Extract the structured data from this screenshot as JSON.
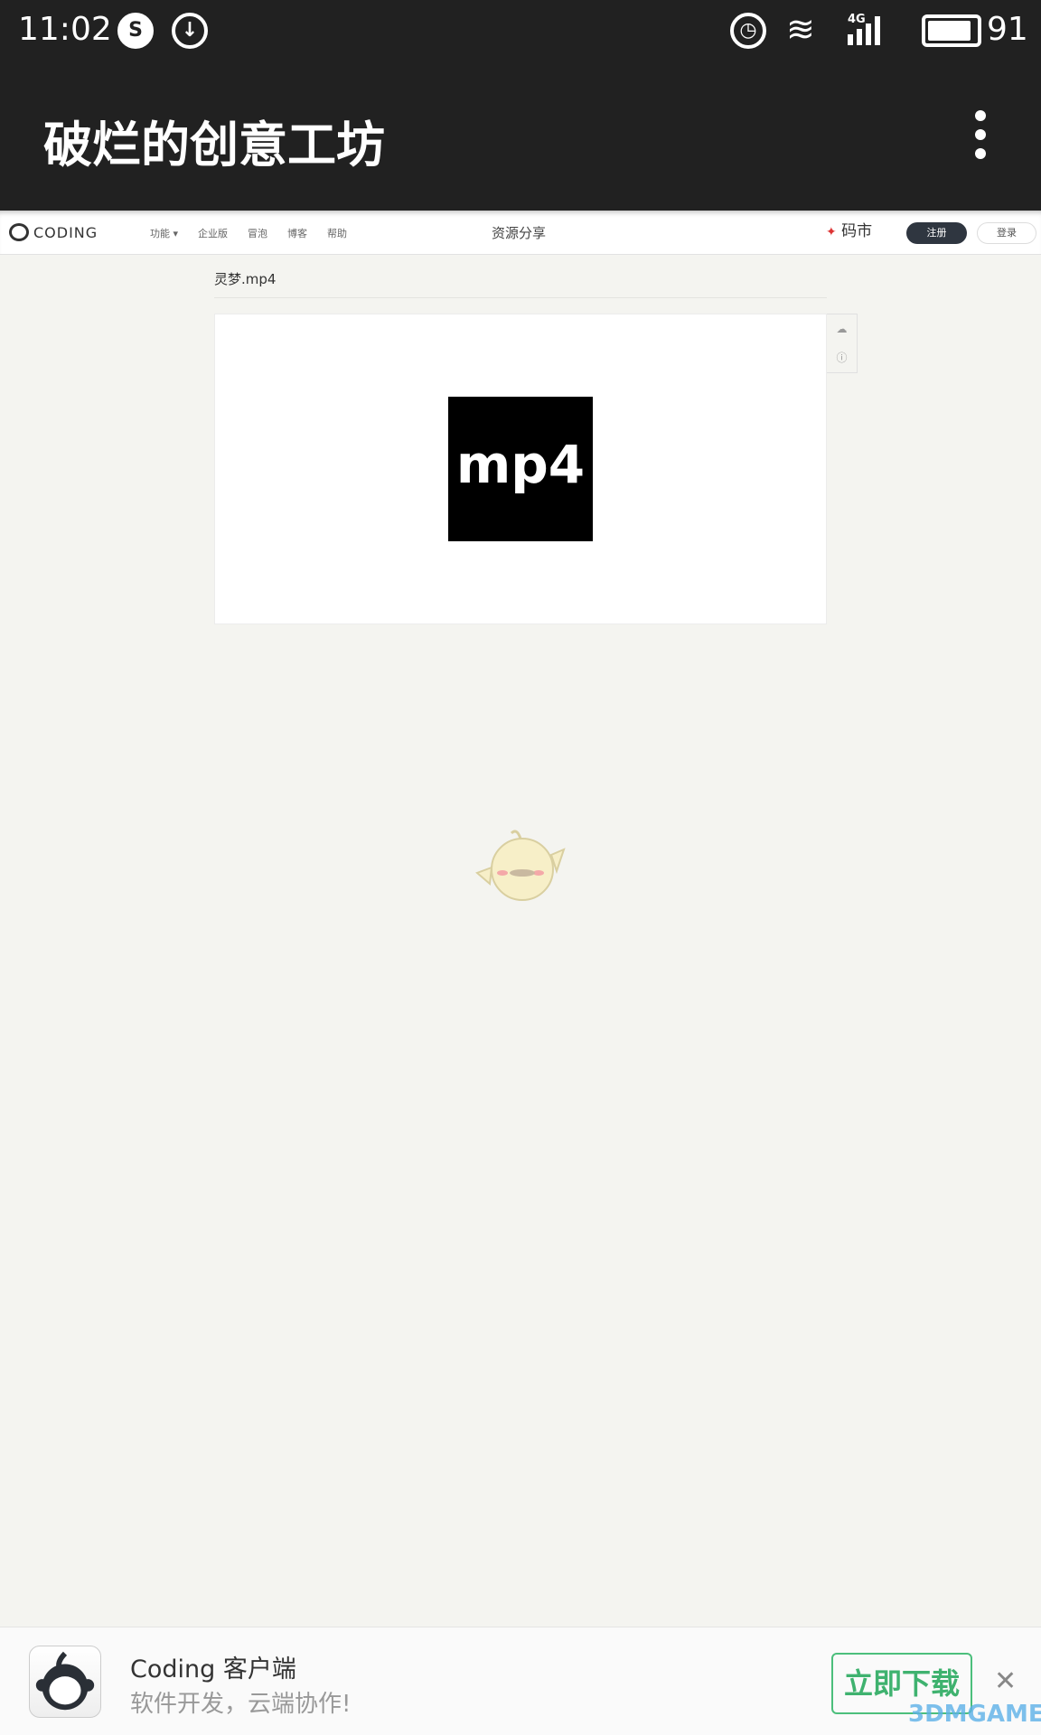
{
  "status_bar": {
    "time": "11:02",
    "battery": "91",
    "battery_level": 0.91,
    "network": "4G"
  },
  "app_bar": {
    "title": "破烂的创意工坊"
  },
  "site_nav": {
    "logo": "CODING",
    "items": [
      "功能 ▾",
      "企业版",
      "冒泡",
      "博客",
      "帮助"
    ],
    "center": "资源分享",
    "market": "码市",
    "register": "注册",
    "login": "登录"
  },
  "file": {
    "name": "灵梦.mp4",
    "type_label": "mp4"
  },
  "banner": {
    "title": "Coding 客户端",
    "subtitle": "软件开发，云端协作!",
    "download": "立即下载",
    "watermark": "3DMGAME"
  }
}
